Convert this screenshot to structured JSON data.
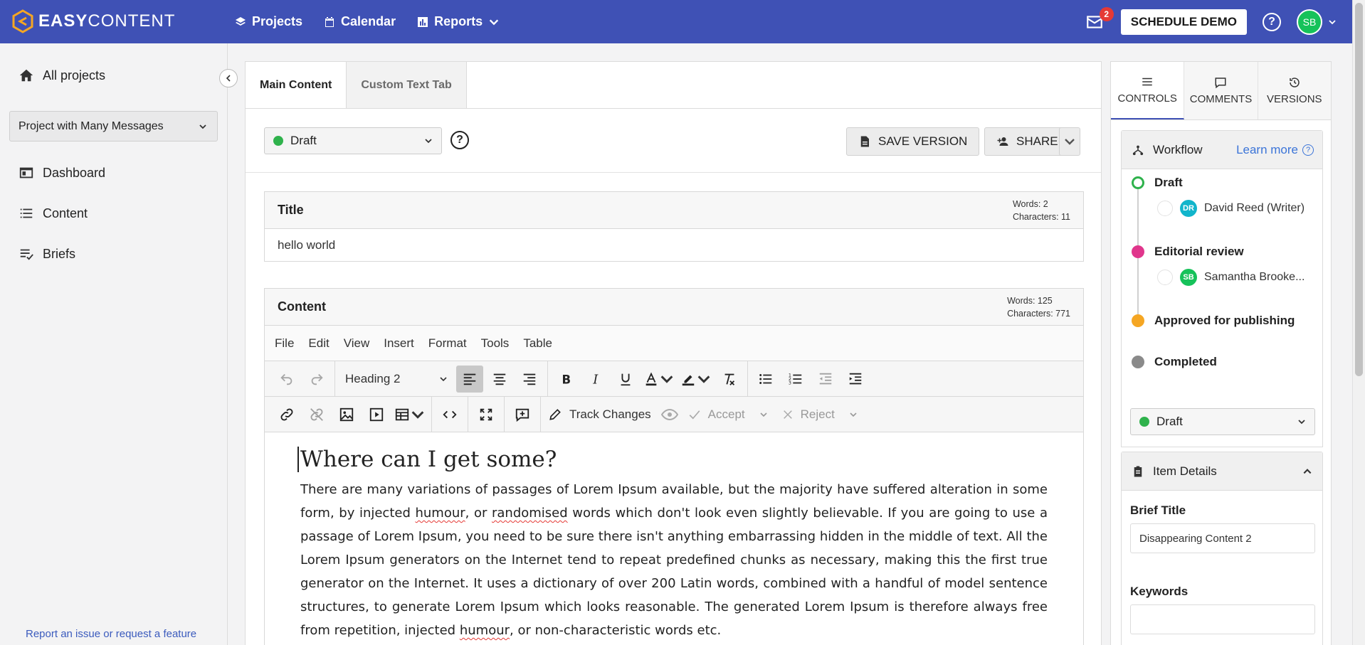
{
  "brand": {
    "name_bold": "EASY",
    "name_light": "CONTENT"
  },
  "nav": [
    {
      "label": "Projects",
      "icon": "layers-icon"
    },
    {
      "label": "Calendar",
      "icon": "calendar-icon"
    },
    {
      "label": "Reports",
      "icon": "bar-chart-icon"
    }
  ],
  "topbar": {
    "notification_count": "2",
    "demo_label": "SCHEDULE DEMO",
    "help": "?",
    "user_initials": "SB"
  },
  "sidebar": {
    "all_projects": "All projects",
    "project_select": "Project with Many Messages",
    "items": [
      "Dashboard",
      "Content",
      "Briefs"
    ],
    "report_link": "Report an issue or request a feature"
  },
  "editor_tabs": [
    "Main Content",
    "Custom Text Tab"
  ],
  "status": {
    "label": "Draft",
    "color": "#2fb24c"
  },
  "actions": {
    "save_version": "SAVE VERSION",
    "share": "SHARE"
  },
  "title_field": {
    "label": "Title",
    "words": "Words: 2",
    "characters": "Characters: 11",
    "value": "hello world"
  },
  "content_field": {
    "label": "Content",
    "words": "Words: 125",
    "characters": "Characters: 771",
    "menu": [
      "File",
      "Edit",
      "View",
      "Insert",
      "Format",
      "Tools",
      "Table"
    ],
    "block_format": "Heading 2",
    "track_changes": "Track Changes",
    "accept": "Accept",
    "reject": "Reject",
    "heading": "Where can I get some?",
    "paragraph_parts": [
      "There are many variations of passages of Lorem Ipsum available, but the majority have suffered alteration in some form, by injected ",
      "humour",
      ", or ",
      "randomised",
      " words which don't look even slightly believable. If you are going to use a passage of Lorem Ipsum, you need to be sure there isn't anything embarrassing hidden in the middle of text. All the Lorem Ipsum generators on the Internet tend to repeat predefined chunks as necessary, making this the first true generator on the Internet. It uses a dictionary of over 200 Latin words, combined with a handful of model sentence structures, to generate Lorem Ipsum which looks reasonable. The generated Lorem Ipsum is therefore always free from repetition, injected ",
      "humour",
      ", or non-characteristic words etc."
    ]
  },
  "right_tabs": [
    "CONTROLS",
    "COMMENTS",
    "VERSIONS"
  ],
  "workflow": {
    "title": "Workflow",
    "learn_more": "Learn more",
    "steps": [
      {
        "name": "Draft",
        "color": "#2fb24c",
        "user": "David Reed (Writer)",
        "initials": "DR",
        "avatar_color": "#12b5cb"
      },
      {
        "name": "Editorial review",
        "color": "#e0368c",
        "user": "Samantha Brooke...",
        "initials": "SB",
        "avatar_color": "#16c25a"
      },
      {
        "name": "Approved for publishing",
        "color": "#f5a623"
      },
      {
        "name": "Completed",
        "color": "#8a8a8a"
      }
    ],
    "current": "Draft"
  },
  "item_details": {
    "title": "Item Details",
    "brief_title_label": "Brief Title",
    "brief_title_value": "Disappearing Content 2",
    "keywords_label": "Keywords",
    "keywords_value": ""
  }
}
